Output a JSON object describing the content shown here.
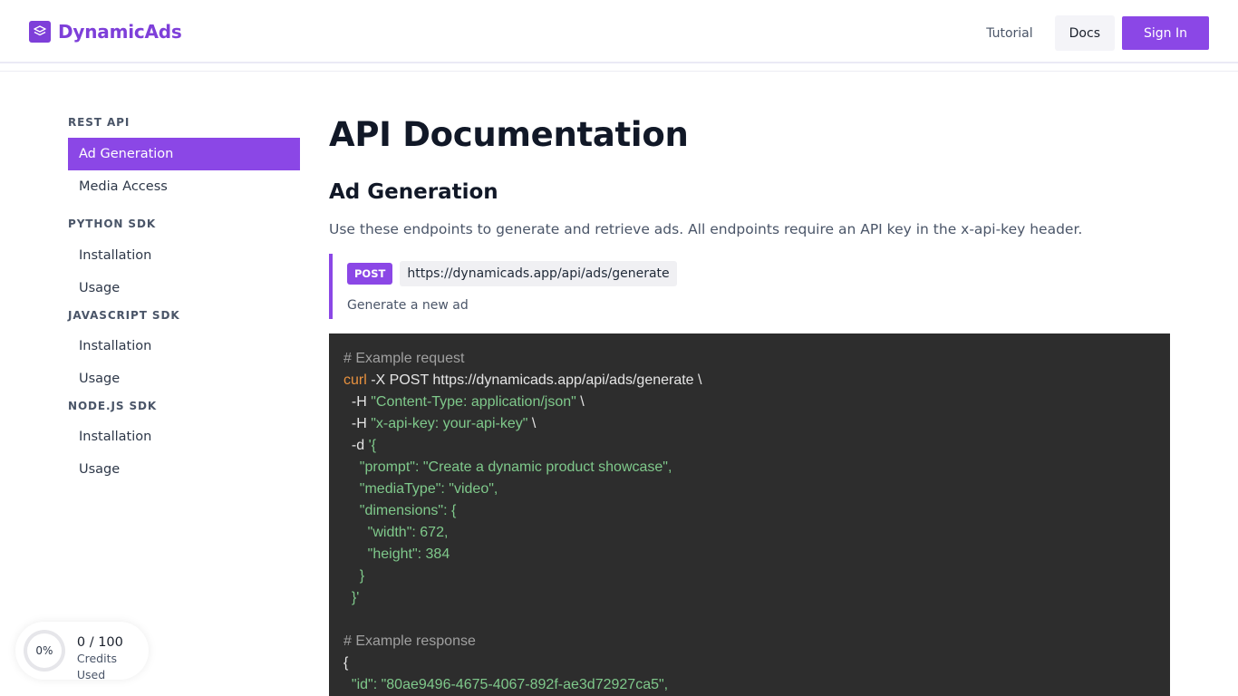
{
  "brand": {
    "name": "DynamicAds",
    "icon": "layers-icon",
    "color": "#7e3fd9"
  },
  "nav": {
    "tutorial": "Tutorial",
    "docs": "Docs",
    "sign_in": "Sign In"
  },
  "sidebar": {
    "sections": [
      {
        "title": "REST API",
        "items": [
          "Ad Generation",
          "Media Access"
        ]
      },
      {
        "title": "PYTHON SDK",
        "items": [
          "Installation",
          "Usage"
        ]
      },
      {
        "title": "JAVASCRIPT SDK",
        "items": [
          "Installation",
          "Usage"
        ]
      },
      {
        "title": "NODE.JS SDK",
        "items": [
          "Installation",
          "Usage"
        ]
      }
    ],
    "active_item": "Ad Generation"
  },
  "main": {
    "title": "API Documentation",
    "section_heading": "Ad Generation",
    "intro": "Use these endpoints to generate and retrieve ads. All endpoints require an API key in the x-api-key header.",
    "endpoint": {
      "method": "POST",
      "url": "https://dynamicads.app/api/ads/generate",
      "description": "Generate a new ad"
    },
    "code": {
      "lines": [
        "# Example request",
        "curl -X POST https://dynamicads.app/api/ads/generate \\",
        "  -H \"Content-Type: application/json\" \\",
        "  -H \"x-api-key: your-api-key\" \\",
        "  -d '{",
        "    \"prompt\": \"Create a dynamic product showcase\",",
        "    \"mediaType\": \"video\",",
        "    \"dimensions\": {",
        "      \"width\": 672,",
        "      \"height\": 384",
        "    }",
        "  }'",
        "",
        "# Example response",
        "{",
        "  \"id\": \"80ae9496-4675-4067-892f-ae3d72927ca5\","
      ]
    }
  },
  "credits": {
    "percent": "0%",
    "count": "0 / 100",
    "label": "Credits Used",
    "used_fraction": 0
  },
  "colors": {
    "accent": "#8b47e6",
    "code_bg": "#2d2d2d",
    "code_comment": "#a0a0a0",
    "code_command": "#e8913e",
    "code_string": "#7fc98b"
  }
}
